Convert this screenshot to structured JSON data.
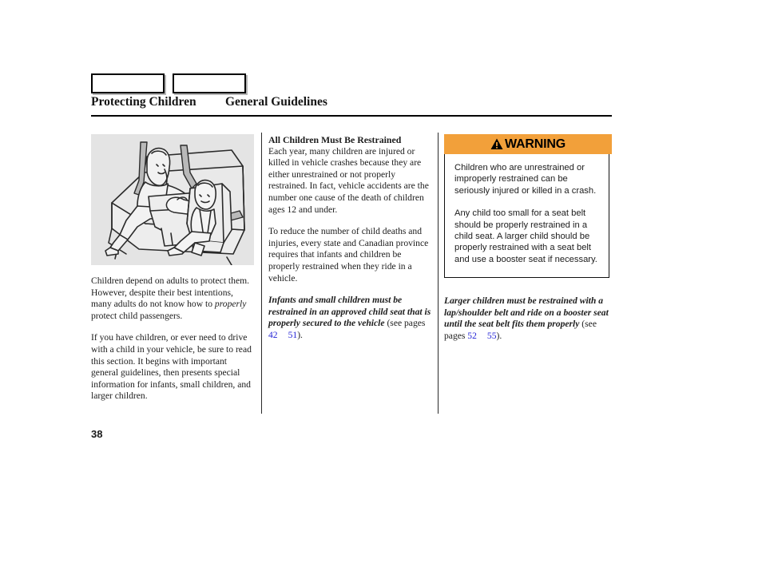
{
  "header": {
    "tabs": [
      {
        "label": ""
      },
      {
        "label": ""
      }
    ],
    "title": "Protecting Children",
    "subtitle": "General Guidelines"
  },
  "figure": {
    "caption": "Illustration of a rear vehicle seat with an adult holding an infant in a rear-facing infant carrier and a child secured in a forward-facing child safety seat, both with seat belts",
    "background_color": "#e4e4e4"
  },
  "column1": {
    "paragraphs": [
      {
        "runs": [
          {
            "text": "Children depend on adults to protect them. However, despite their best intentions, many adults do not know how to ",
            "style": "normal"
          },
          {
            "text": "properly",
            "style": "italic"
          },
          {
            "text": " protect child passengers.",
            "style": "normal"
          }
        ]
      },
      {
        "runs": [
          {
            "text": "If you have children, or ever need to drive with a child in your vehicle, be sure to read this section. It begins with important general guidelines, then presents special information for infants, small children, and larger children.",
            "style": "normal"
          }
        ]
      }
    ]
  },
  "column2": {
    "heading": "All Children Must Be Restrained",
    "paragraph1": "Each year, many children are injured or killed in vehicle crashes because they are either unrestrained or not properly restrained. In fact, vehicle accidents are the number one cause of the death of children ages 12 and under.",
    "paragraph2": "To reduce the number of child deaths and injuries, every state and Canadian province requires that infants and children be properly restrained when they ride in a vehicle.",
    "emphasis": "Infants and small children must be restrained in an approved child seat that is properly secured to the vehicle",
    "see_pages_prefix": " (see pages ",
    "page_ref_1": "42",
    "page_ref_2": "51",
    "see_pages_suffix": ").",
    "link_color": "#2727d6"
  },
  "warning": {
    "icon": "warning-triangle-icon",
    "label": "WARNING",
    "header_color": "#f2a03a",
    "paragraphs": [
      "Children who are unrestrained or improperly restrained can be seriously injured or killed in a crash.",
      "Any child too small for a seat belt should be properly restrained in a child seat. A larger child should be properly restrained with a seat belt and use a booster seat if necessary."
    ]
  },
  "column3_note": {
    "emphasis": "Larger children must be restrained with a lap/shoulder belt and ride on a booster seat until the seat belt fits them properly",
    "see_pages_prefix": " (see pages ",
    "page_ref_1": "52",
    "page_ref_2": "55",
    "see_pages_suffix": ")."
  },
  "footer": {
    "page_number": "38"
  }
}
